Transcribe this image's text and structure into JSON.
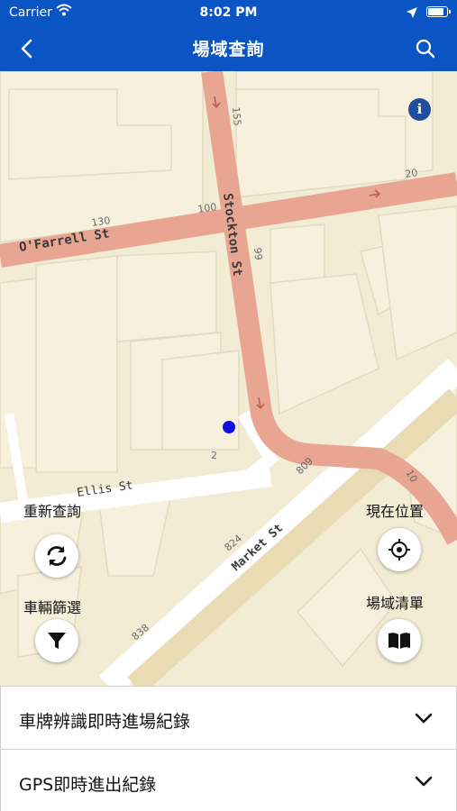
{
  "status_bar": {
    "carrier": "Carrier",
    "time": "8:02 PM"
  },
  "header": {
    "title": "場域查詢"
  },
  "map": {
    "streets": {
      "ofarrell": "O'Farrell St",
      "stockton": "Stockton St",
      "ellis": "Ellis St",
      "market": "Market St"
    },
    "numbers": [
      "155",
      "130",
      "100",
      "20",
      "99",
      "2",
      "809",
      "10",
      "824",
      "838"
    ]
  },
  "controls": {
    "refresh_label": "重新查詢",
    "filter_label": "車輛篩選",
    "location_label": "現在位置",
    "site_list_label": "場域清單"
  },
  "panels": [
    {
      "label": "車牌辨識即時進場紀錄"
    },
    {
      "label": "GPS即時進出紀錄"
    }
  ],
  "colors": {
    "header": "#0a55c3",
    "road": "#e8a592",
    "map_bg": "#f2ecd5"
  }
}
